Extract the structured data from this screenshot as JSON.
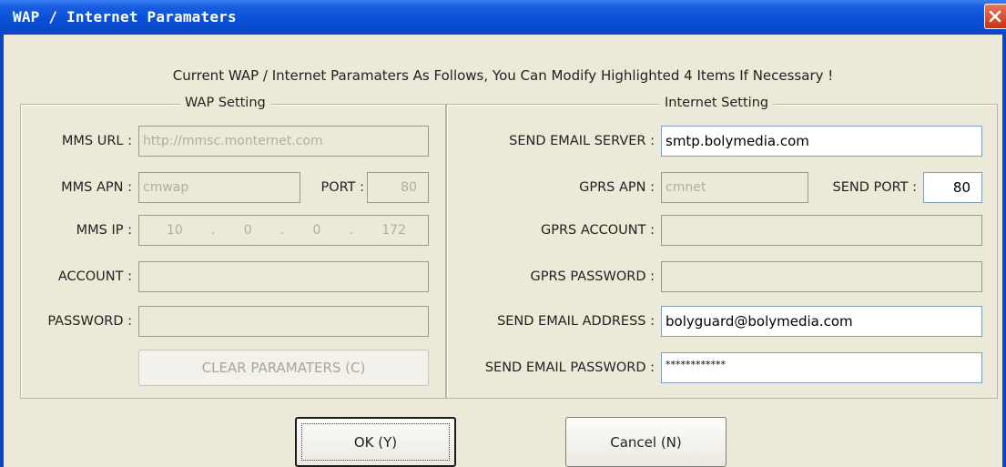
{
  "window": {
    "title": "WAP / Internet Paramaters",
    "header": "Current WAP / Internet Paramaters As Follows, You Can Modify Highlighted 4 Items If Necessary !"
  },
  "wap_setting": {
    "legend": "WAP Setting",
    "mms_url_label": "MMS URL :",
    "mms_url_value": "http://mmsc.monternet.com",
    "mms_apn_label": "MMS APN :",
    "mms_apn_value": "cmwap",
    "port_label": "PORT :",
    "port_value": "80",
    "mms_ip_label": "MMS IP :",
    "mms_ip_octets": [
      "10",
      ".",
      "0",
      ".",
      "0",
      ".",
      "172"
    ],
    "account_label": "ACCOUNT :",
    "account_value": "",
    "password_label": "PASSWORD :",
    "password_value": "",
    "clear_button": "CLEAR PARAMATERS (C)"
  },
  "internet_setting": {
    "legend": "Internet Setting",
    "send_email_server_label": "SEND EMAIL SERVER :",
    "send_email_server_value": "smtp.bolymedia.com",
    "gprs_apn_label": "GPRS APN :",
    "gprs_apn_value": "cmnet",
    "send_port_label": "SEND PORT :",
    "send_port_value": "80",
    "gprs_account_label": "GPRS ACCOUNT :",
    "gprs_account_value": "",
    "gprs_password_label": "GPRS PASSWORD :",
    "gprs_password_value": "",
    "send_email_address_label": "SEND EMAIL ADDRESS :",
    "send_email_address_value": "bolyguard@bolymedia.com",
    "send_email_password_label": "SEND EMAIL PASSWORD :",
    "send_email_password_value": "************"
  },
  "buttons": {
    "ok": "OK (Y)",
    "cancel": "Cancel (N)"
  },
  "icons": {
    "close": "close-icon"
  },
  "colors": {
    "titlebar": "#0a4fd8",
    "dialog_bg": "#ece9d8",
    "close_button": "#c23413"
  }
}
